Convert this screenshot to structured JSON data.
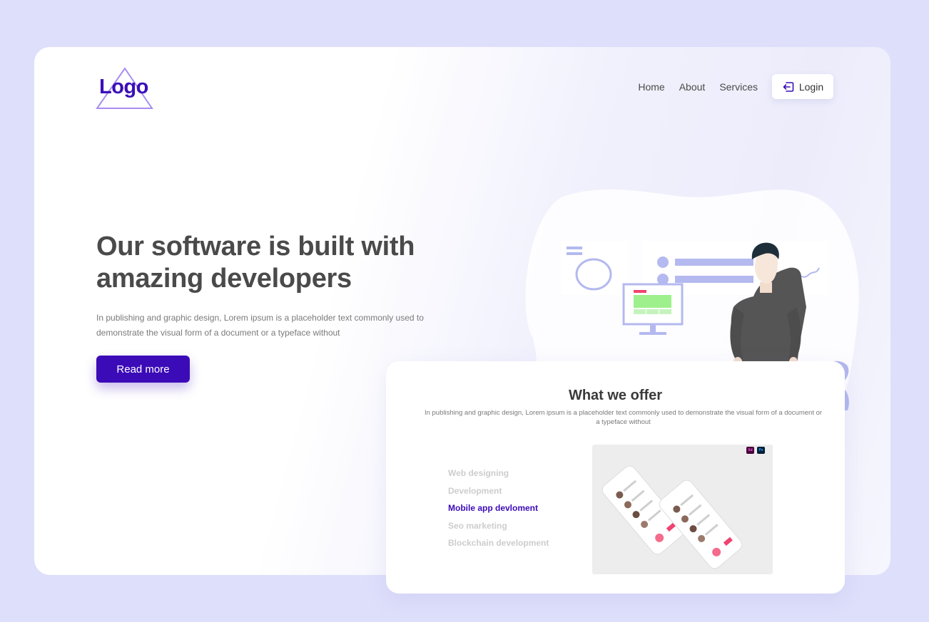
{
  "logo": {
    "text": "Logo"
  },
  "nav": {
    "links": [
      "Home",
      "About",
      "Services"
    ],
    "login_label": "Login"
  },
  "hero": {
    "title_line1": "Our software is built with",
    "title_line2": "amazing developers",
    "description": "In publishing and graphic design, Lorem ipsum is a placeholder text commonly used to demonstrate the visual form of a document or a typeface without",
    "cta_label": "Read more"
  },
  "offer": {
    "title": "What we offer",
    "description": "In publishing and graphic design, Lorem ipsum is a placeholder text commonly used to demonstrate the visual form of a document or a typeface without",
    "services": [
      "Web designing",
      "Development",
      "Mobile app devloment",
      "Seo  marketing",
      "Blockchain development"
    ],
    "active_service_index": 2,
    "badges": [
      "Xd",
      "Ps"
    ]
  },
  "colors": {
    "background": "#dedffb",
    "accent": "#3c0bb8",
    "heading": "#4a4a4a",
    "illustration": "#b4b9ef"
  },
  "icons": [
    "login-icon"
  ]
}
